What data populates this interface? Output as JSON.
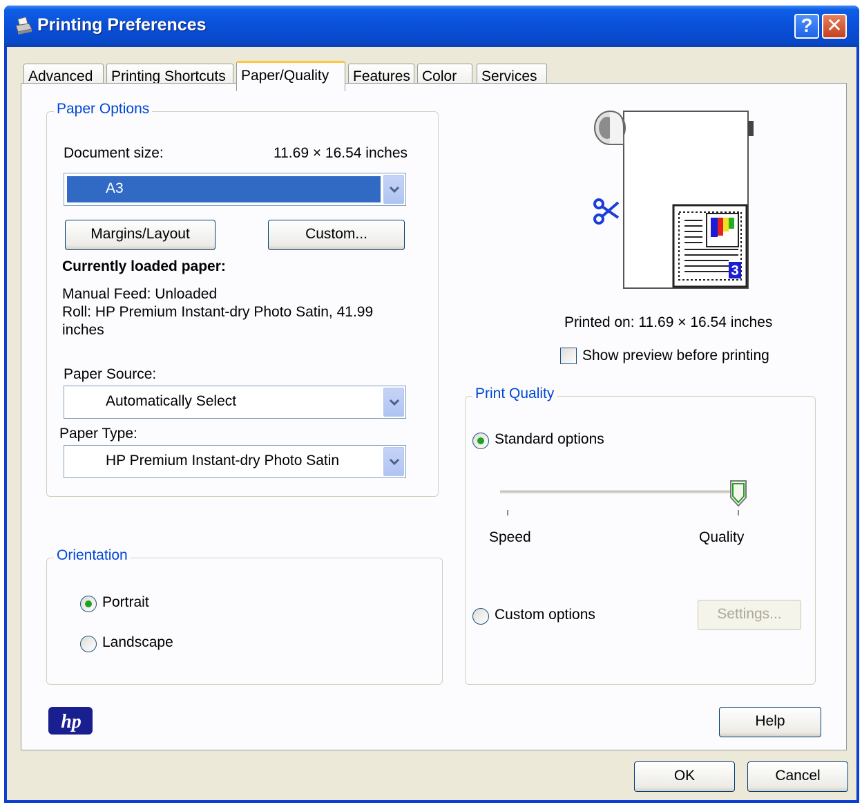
{
  "window": {
    "title": "Printing Preferences",
    "help_glyph": "?",
    "close_glyph": "✕"
  },
  "tabs": [
    {
      "label": "Advanced"
    },
    {
      "label": "Printing Shortcuts"
    },
    {
      "label": "Paper/Quality"
    },
    {
      "label": "Features"
    },
    {
      "label": "Color"
    },
    {
      "label": "Services"
    }
  ],
  "active_tab": "Paper/Quality",
  "paper_options": {
    "legend": "Paper Options",
    "document_size_label": "Document size:",
    "document_size_value": "11.69 × 16.54 inches",
    "size_select": "A3",
    "margins_button": "Margins/Layout",
    "custom_button": "Custom...",
    "loaded_heading": "Currently loaded paper:",
    "loaded_line1": "Manual Feed: Unloaded",
    "loaded_line2": "Roll:  HP Premium Instant-dry Photo Satin, 41.99",
    "loaded_line3": "inches",
    "source_label": "Paper Source:",
    "source_select": "Automatically Select",
    "type_label": "Paper Type:",
    "type_select": "HP Premium Instant-dry Photo Satin"
  },
  "orientation": {
    "legend": "Orientation",
    "portrait": "Portrait",
    "landscape": "Landscape",
    "selected": "Portrait"
  },
  "preview": {
    "printed_on": "Printed on: 11.69 × 16.54 inches",
    "show_preview_label": "Show preview before printing",
    "show_preview_checked": false,
    "page_number": "3",
    "scissors_icon": "scissors-icon"
  },
  "print_quality": {
    "legend": "Print Quality",
    "standard_label": "Standard options",
    "custom_label": "Custom options",
    "selected": "Standard options",
    "speed_label": "Speed",
    "quality_label": "Quality",
    "slider_level": 1.0,
    "settings_button": "Settings..."
  },
  "footer": {
    "logo_text": "hp",
    "help_button": "Help",
    "ok_button": "OK",
    "cancel_button": "Cancel"
  },
  "colors": {
    "title_bar": "#0a4fd8",
    "accent_blue": "#0046d5",
    "selection": "#316ac5",
    "hp_logo": "#1a1f8f"
  }
}
